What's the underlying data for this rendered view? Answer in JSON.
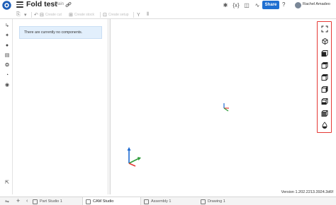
{
  "header": {
    "title": "Fold test",
    "branch": "Main",
    "share_label": "Share",
    "help_label": "?",
    "user_name": "Rachel Amadeo"
  },
  "toolbar": {
    "create_cut": "Create cut",
    "create_stock": "Create stock",
    "create_setup": "Create setup"
  },
  "panel": {
    "empty_message": "There are currently no components."
  },
  "viewport": {
    "version": "Version 1.202.2213.3924.3d6f"
  },
  "tabs": [
    {
      "label": "Part Studio 1",
      "active": false
    },
    {
      "label": "CAM Studio",
      "active": true
    },
    {
      "label": "Assembly 1",
      "active": false
    },
    {
      "label": "Drawing 1",
      "active": false
    }
  ],
  "colors": {
    "accent": "#1f6fd1",
    "highlight_box": "#e53935",
    "axis_x": "#e53935",
    "axis_y": "#2e9c3a",
    "axis_z": "#1e6ad1"
  },
  "icons": {
    "view_panel": [
      "fit-view-icon",
      "cube-isometric-icon",
      "cube-front-icon",
      "cube-back-icon",
      "cube-top-icon",
      "cube-left-icon",
      "cube-right-icon",
      "cube-bottom-icon",
      "render-mode-icon"
    ]
  }
}
